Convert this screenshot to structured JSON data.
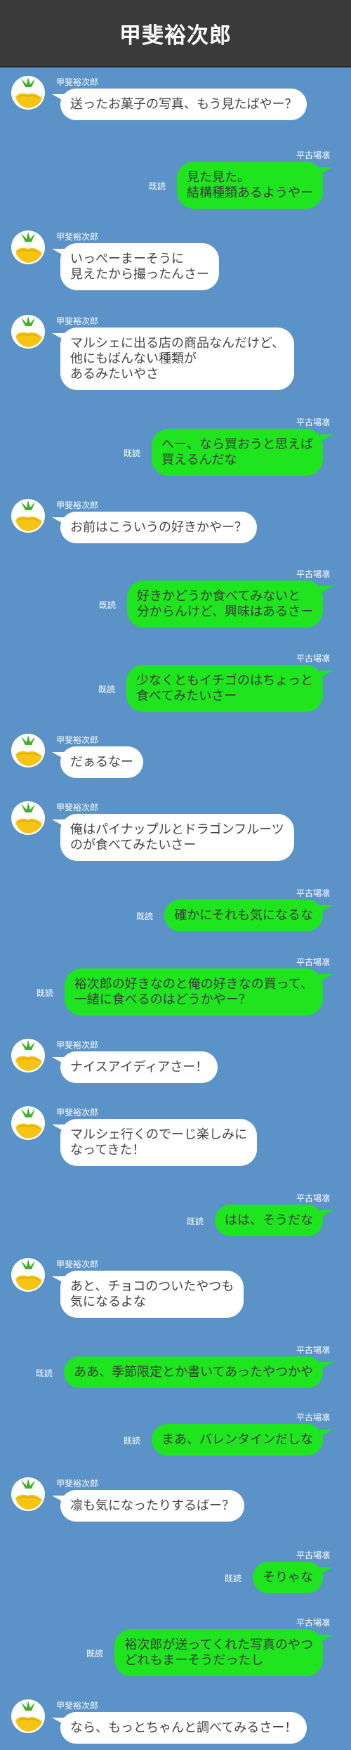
{
  "header": {
    "title": "甲斐裕次郎"
  },
  "colors": {
    "background": "#5b93c8",
    "header": "#3a3a3a",
    "right_bubble": "#1ee51e",
    "left_bubble": "#ffffff"
  },
  "avatar_icon": "pineapple-icon",
  "read_label": "既読",
  "messages": [
    {
      "side": "left",
      "name": "甲斐裕次郎",
      "text": "送ったお菓子の写真、もう見たばやー？"
    },
    {
      "side": "right",
      "name": "平古場凛",
      "read": "既読",
      "text": "見た見た。\n結構種類あるようやー"
    },
    {
      "side": "left",
      "name": "甲斐裕次郎",
      "text": "いっぺーまーそうに\n見えたから撮ったんさー"
    },
    {
      "side": "left",
      "name": "甲斐裕次郎",
      "text": "マルシェに出る店の商品なんだけど、\n他にもばんない種類が\nあるみたいやさ"
    },
    {
      "side": "right",
      "name": "平古場凛",
      "read": "既読",
      "text": "へー、なら買おうと思えば\n買えるんだな"
    },
    {
      "side": "left",
      "name": "甲斐裕次郎",
      "text": "お前はこういうの好きかやー？"
    },
    {
      "side": "right",
      "name": "平古場凛",
      "read": "既読",
      "text": "好きかどうか食べてみないと\n分からんけど、興味はあるさー"
    },
    {
      "side": "right",
      "name": "平古場凛",
      "read": "既読",
      "text": "少なくともイチゴのはちょっと\n食べてみたいさー"
    },
    {
      "side": "left",
      "name": "甲斐裕次郎",
      "text": "だぁるなー"
    },
    {
      "side": "left",
      "name": "甲斐裕次郎",
      "text": "俺はパイナップルとドラゴンフルーツ\nのが食べてみたいさー"
    },
    {
      "side": "right",
      "name": "平古場凛",
      "read": "既読",
      "text": "確かにそれも気になるな"
    },
    {
      "side": "right",
      "name": "平古場凛",
      "read": "既読",
      "text": "裕次郎の好きなのと俺の好きなの買って、\n一緒に食べるのはどうかやー？"
    },
    {
      "side": "left",
      "name": "甲斐裕次郎",
      "text": "ナイスアイディアさー！"
    },
    {
      "side": "left",
      "name": "甲斐裕次郎",
      "text": "マルシェ行くのでーじ楽しみに\nなってきた！"
    },
    {
      "side": "right",
      "name": "平古場凛",
      "read": "既読",
      "text": "はは、そうだな"
    },
    {
      "side": "left",
      "name": "甲斐裕次郎",
      "text": "あと、チョコのついたやつも\n気になるよな"
    },
    {
      "side": "right",
      "name": "平古場凛",
      "read": "既読",
      "text": "ああ、季節限定とか書いてあったやつかや"
    },
    {
      "side": "right",
      "name": "平古場凛",
      "read": "既読",
      "text": "まあ、バレンタインだしな"
    },
    {
      "side": "left",
      "name": "甲斐裕次郎",
      "text": "凛も気になったりするばー？"
    },
    {
      "side": "right",
      "name": "平古場凛",
      "read": "既読",
      "text": "そりゃな"
    },
    {
      "side": "right",
      "name": "平古場凛",
      "read": "既読",
      "text": "裕次郎が送ってくれた写真のやつ\nどれもまーそうだったし"
    },
    {
      "side": "left",
      "name": "甲斐裕次郎",
      "text": "なら、もっとちゃんと調べてみるさー！"
    }
  ]
}
